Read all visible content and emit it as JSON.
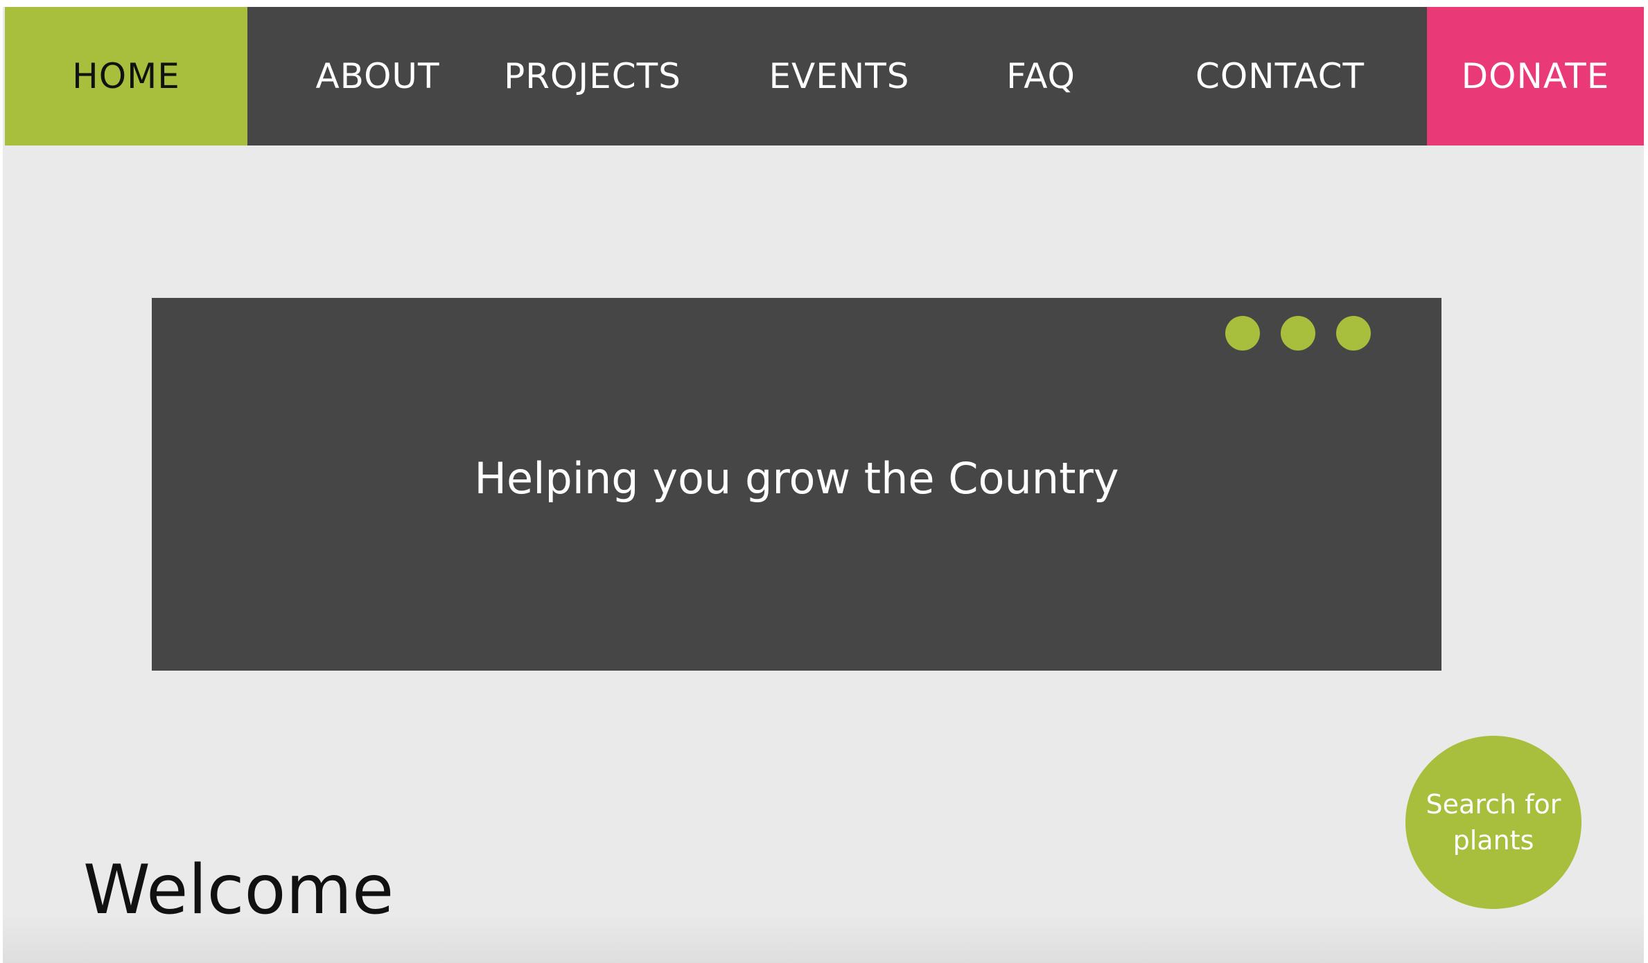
{
  "nav": {
    "items": [
      {
        "label": "HOME",
        "active": true
      },
      {
        "label": "ABOUT"
      },
      {
        "label": "PROJECTS"
      },
      {
        "label": "EVENTS"
      },
      {
        "label": "FAQ"
      },
      {
        "label": "CONTACT"
      },
      {
        "label": "DONATE",
        "highlight": true
      }
    ]
  },
  "hero": {
    "title": "Helping you grow the Country",
    "slide_count": 3
  },
  "search_button": {
    "line1": "Search for",
    "line2": "plants"
  },
  "welcome": {
    "heading": "Welcome"
  },
  "colors": {
    "accent_green": "#a7bf3c",
    "donate_pink": "#e93a77",
    "nav_dark": "#464646",
    "page_bg": "#eaeaea"
  }
}
